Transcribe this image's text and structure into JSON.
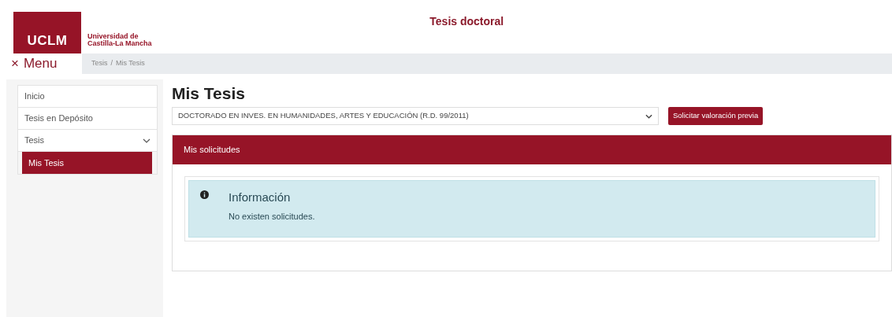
{
  "header": {
    "logo": "UCLM",
    "university_line_1": "Universidad de",
    "university_line_2": "Castilla-La Mancha",
    "title": "Tesis doctoral"
  },
  "menu_toggle": {
    "icon": "×",
    "label": "Menu"
  },
  "breadcrumb": {
    "items": [
      "Tesis",
      "Mis Tesis"
    ],
    "separator": "/"
  },
  "sidebar": {
    "items": [
      {
        "label": "Inicio",
        "selected": false
      },
      {
        "label": "Tesis en Depósito",
        "selected": false
      },
      {
        "label": "Tesis",
        "selected": false,
        "expanded": true,
        "children": [
          {
            "label": "Mis Tesis",
            "selected": true
          }
        ]
      }
    ]
  },
  "main": {
    "heading": "Mis Tesis",
    "program_select": {
      "value": "DOCTORADO EN INVES. EN HUMANIDADES, ARTES Y EDUCACIÓN (R.D. 99/2011)"
    },
    "button": "Solicitar valoración previa",
    "panel": {
      "title": "Mis solicitudes",
      "alert": {
        "title": "Información",
        "message": "No existen solicitudes."
      }
    }
  }
}
